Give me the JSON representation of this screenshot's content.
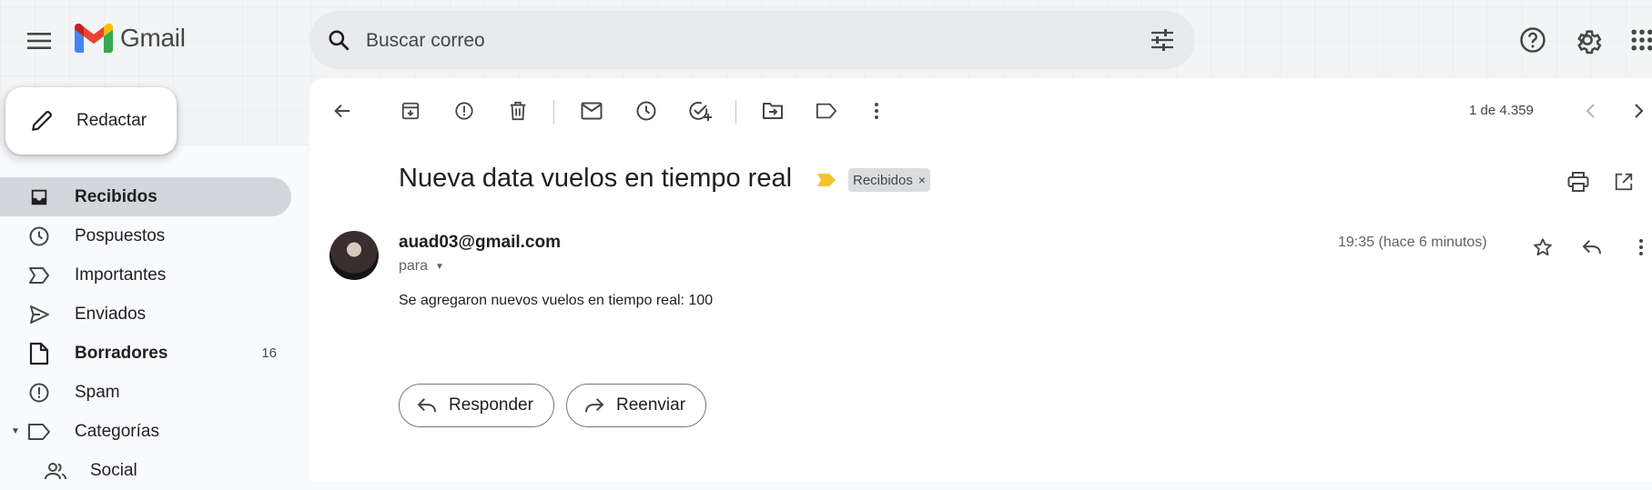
{
  "app": {
    "name": "Gmail"
  },
  "search": {
    "placeholder": "Buscar correo"
  },
  "compose": {
    "label": "Redactar"
  },
  "sidebar": {
    "items": [
      {
        "label": "Recibidos",
        "icon": "inbox-icon",
        "active": true,
        "bold": true,
        "count": ""
      },
      {
        "label": "Pospuestos",
        "icon": "clock-icon",
        "count": ""
      },
      {
        "label": "Importantes",
        "icon": "important-icon",
        "count": ""
      },
      {
        "label": "Enviados",
        "icon": "send-icon",
        "count": ""
      },
      {
        "label": "Borradores",
        "icon": "draft-icon",
        "bold": true,
        "count": "16"
      },
      {
        "label": "Spam",
        "icon": "spam-icon",
        "count": ""
      },
      {
        "label": "Categorías",
        "icon": "label-icon",
        "count": ""
      },
      {
        "label": "Social",
        "icon": "people-icon",
        "count": ""
      }
    ]
  },
  "toolbar": {
    "pager": "1 de 4.359"
  },
  "message": {
    "subject": "Nueva data vuelos en tiempo real",
    "label_chip": "Recibidos",
    "label_remove": "×",
    "sender": "auad03@gmail.com",
    "to_prefix": "para",
    "timestamp": "19:35 (hace 6 minutos)",
    "body": "Se agregaron nuevos vuelos en tiempo real: 100"
  },
  "actions": {
    "reply": "Responder",
    "forward": "Reenviar"
  },
  "colors": {
    "important_marker": "#f2c230",
    "active_nav_bg": "#d3d6db",
    "search_bg": "#e9eaee"
  }
}
